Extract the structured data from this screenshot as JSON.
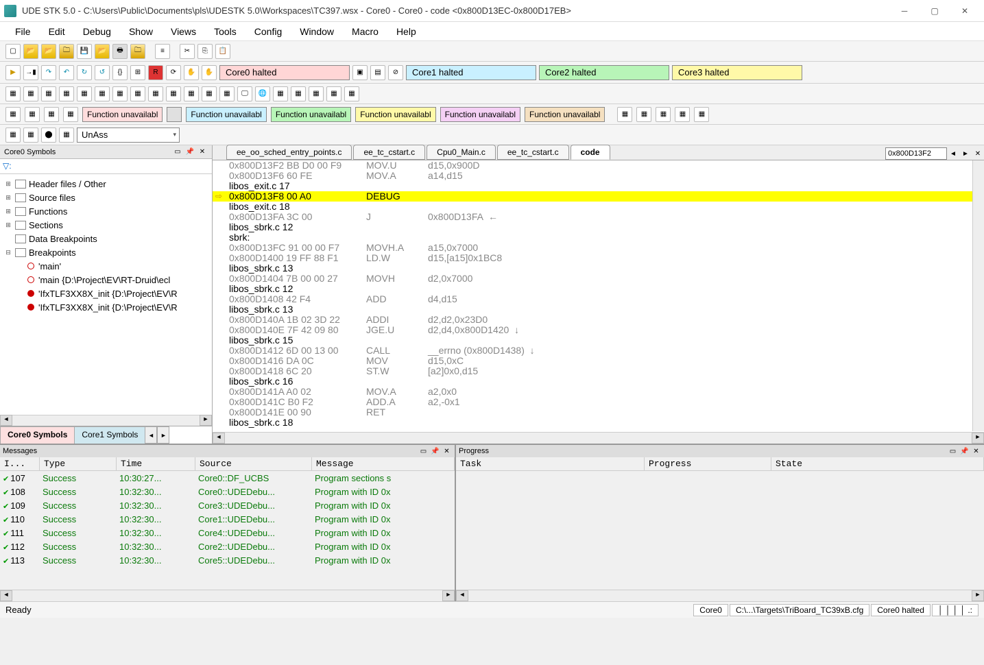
{
  "window": {
    "title": "UDE STK 5.0 - C:\\Users\\Public\\Documents\\pls\\UDESTK 5.0\\Workspaces\\TC397.wsx - Core0 - Core0 - code <0x800D13EC-0x800D17EB>"
  },
  "menu": [
    "File",
    "Edit",
    "Debug",
    "Show",
    "Views",
    "Tools",
    "Config",
    "Window",
    "Macro",
    "Help"
  ],
  "cores": {
    "c0": "Core0 halted",
    "c1": "Core1 halted",
    "c2": "Core2 halted",
    "c3": "Core3 halted"
  },
  "func_label": "Function unavailabl",
  "combo_unass": "UnAss",
  "left": {
    "title": "Core0 Symbols",
    "filter_icon": "▽:",
    "nodes": [
      {
        "exp": "⊞",
        "label": "Header files / Other"
      },
      {
        "exp": "⊞",
        "label": "Source files"
      },
      {
        "exp": "⊞",
        "label": "Functions"
      },
      {
        "exp": "⊞",
        "label": "Sections"
      },
      {
        "exp": "",
        "label": "Data Breakpoints"
      },
      {
        "exp": "⊟",
        "label": "Breakpoints"
      }
    ],
    "bps": [
      {
        "filled": false,
        "label": "'main'"
      },
      {
        "filled": false,
        "label": "'main {D:\\Project\\EV\\RT-Druid\\ecl"
      },
      {
        "filled": true,
        "label": "'IfxTLF3XX8X_init {D:\\Project\\EV\\R"
      },
      {
        "filled": true,
        "label": "'IfxTLF3XX8X_init {D:\\Project\\EV\\R"
      }
    ],
    "tabs": {
      "active": "Core0 Symbols",
      "other": "Core1 Symbols"
    }
  },
  "code": {
    "tabs": [
      "ee_oo_sched_entry_points.c",
      "ee_tc_cstart.c",
      "Cpu0_Main.c",
      "ee_tc_cstart.c"
    ],
    "active_tab": "code",
    "addr_box": "0x800D13F2",
    "lines": [
      {
        "t": "asm",
        "a": "0x800D13F2 BB D0 00 F9",
        "m": "MOV.U",
        "o": "d15,0x900D"
      },
      {
        "t": "asm",
        "a": "0x800D13F6 60 FE",
        "m": "MOV.A",
        "o": "a14,d15"
      },
      {
        "t": "src",
        "a": "libos_exit.c 17"
      },
      {
        "t": "asm",
        "hl": true,
        "a": "0x800D13F8 00 A0",
        "m": "DEBUG",
        "o": ""
      },
      {
        "t": "src",
        "a": "libos_exit.c 18"
      },
      {
        "t": "asm",
        "a": "0x800D13FA 3C 00",
        "m": "J",
        "o": "0x800D13FA  ←"
      },
      {
        "t": "src",
        "a": "libos_sbrk.c 12"
      },
      {
        "t": "src",
        "a": "sbrk:"
      },
      {
        "t": "asm",
        "a": "0x800D13FC 91 00 00 F7",
        "m": "MOVH.A",
        "o": "a15,0x7000"
      },
      {
        "t": "asm",
        "a": "0x800D1400 19 FF 88 F1",
        "m": "LD.W",
        "o": "d15,[a15]0x1BC8"
      },
      {
        "t": "src",
        "a": "libos_sbrk.c 13"
      },
      {
        "t": "asm",
        "a": "0x800D1404 7B 00 00 27",
        "m": "MOVH",
        "o": "d2,0x7000"
      },
      {
        "t": "src",
        "a": "libos_sbrk.c 12"
      },
      {
        "t": "asm",
        "a": "0x800D1408 42 F4",
        "m": "ADD",
        "o": "d4,d15"
      },
      {
        "t": "src",
        "a": "libos_sbrk.c 13"
      },
      {
        "t": "asm",
        "a": "0x800D140A 1B 02 3D 22",
        "m": "ADDI",
        "o": "d2,d2,0x23D0"
      },
      {
        "t": "asm",
        "a": "0x800D140E 7F 42 09 80",
        "m": "JGE.U",
        "o": "d2,d4,0x800D1420  ↓"
      },
      {
        "t": "src",
        "a": "libos_sbrk.c 15"
      },
      {
        "t": "asm",
        "a": "0x800D1412 6D 00 13 00",
        "m": "CALL",
        "o": "__errno (0x800D1438)  ↓"
      },
      {
        "t": "asm",
        "a": "0x800D1416 DA 0C",
        "m": "MOV",
        "o": "d15,0xC"
      },
      {
        "t": "asm",
        "a": "0x800D1418 6C 20",
        "m": "ST.W",
        "o": "[a2]0x0,d15"
      },
      {
        "t": "src",
        "a": "libos_sbrk.c 16"
      },
      {
        "t": "asm",
        "a": "0x800D141A A0 02",
        "m": "MOV.A",
        "o": "a2,0x0"
      },
      {
        "t": "asm",
        "a": "0x800D141C B0 F2",
        "m": "ADD.A",
        "o": "a2,-0x1"
      },
      {
        "t": "asm",
        "a": "0x800D141E 00 90",
        "m": "RET",
        "o": ""
      },
      {
        "t": "src",
        "a": "libos_sbrk.c 18"
      }
    ]
  },
  "messages": {
    "title": "Messages",
    "cols": {
      "id": "I...",
      "type": "Type",
      "time": "Time",
      "src": "Source",
      "msg": "Message"
    },
    "rows": [
      {
        "id": "107",
        "type": "Success",
        "time": "10:30:27...",
        "src": "Core0::DF_UCBS",
        "msg": "Program sections s"
      },
      {
        "id": "108",
        "type": "Success",
        "time": "10:32:30...",
        "src": "Core0::UDEDebu...",
        "msg": "Program with ID 0x"
      },
      {
        "id": "109",
        "type": "Success",
        "time": "10:32:30...",
        "src": "Core3::UDEDebu...",
        "msg": "Program with ID 0x"
      },
      {
        "id": "110",
        "type": "Success",
        "time": "10:32:30...",
        "src": "Core1::UDEDebu...",
        "msg": "Program with ID 0x"
      },
      {
        "id": "111",
        "type": "Success",
        "time": "10:32:30...",
        "src": "Core4::UDEDebu...",
        "msg": "Program with ID 0x"
      },
      {
        "id": "112",
        "type": "Success",
        "time": "10:32:30...",
        "src": "Core2::UDEDebu...",
        "msg": "Program with ID 0x"
      },
      {
        "id": "113",
        "type": "Success",
        "time": "10:32:30...",
        "src": "Core5::UDEDebu...",
        "msg": "Program with ID 0x"
      }
    ]
  },
  "progress": {
    "title": "Progress",
    "cols": {
      "task": "Task",
      "prog": "Progress",
      "state": "State"
    }
  },
  "status": {
    "ready": "Ready",
    "core": "Core0",
    "cfg": "C:\\...\\Targets\\TriBoard_TC39xB.cfg",
    "halt": "Core0 halted"
  }
}
